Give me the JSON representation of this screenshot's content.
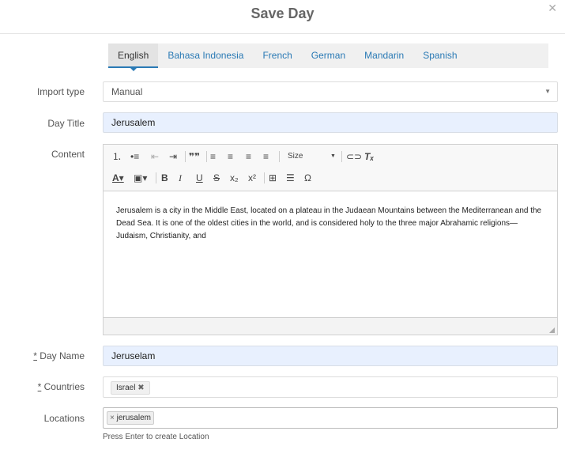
{
  "modal": {
    "title": "Save Day",
    "close_icon": "close-icon"
  },
  "tabs": [
    {
      "label": "English",
      "active": true
    },
    {
      "label": "Bahasa Indonesia"
    },
    {
      "label": "French"
    },
    {
      "label": "German"
    },
    {
      "label": "Mandarin"
    },
    {
      "label": "Spanish"
    }
  ],
  "form": {
    "import_type": {
      "label": "Import type",
      "value": "Manual"
    },
    "day_title": {
      "label": "Day Title",
      "value": "Jerusalem"
    },
    "content": {
      "label": "Content",
      "toolbar": {
        "size_label": "Size"
      },
      "text": "Jerusalem is a city in the Middle East, located on a plateau in the Judaean Mountains between the Mediterranean and the Dead Sea. It is one of the oldest cities in the world, and is considered holy to the three major Abrahamic religions—Judaism, Christianity, and"
    },
    "day_name": {
      "required_mark": "*",
      "label": " Day Name",
      "value": "Jeruselam"
    },
    "countries": {
      "required_mark": "*",
      "label": " Countries",
      "tags": [
        {
          "label": "Israel",
          "remove": "✖"
        }
      ]
    },
    "locations": {
      "label": "Locations",
      "tags": [
        {
          "remove": "×",
          "label": "jerusalem"
        }
      ],
      "help": "Press Enter to create Location"
    }
  },
  "colors": {
    "link": "#2a7ab5",
    "autofill": "#e8f0fe"
  }
}
